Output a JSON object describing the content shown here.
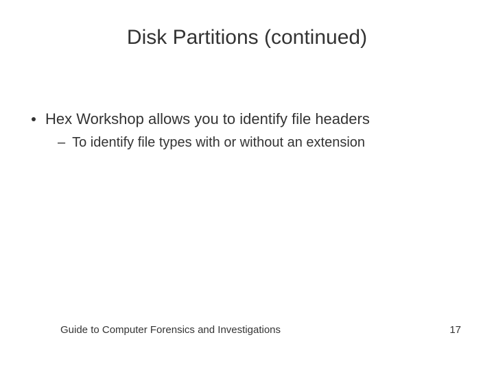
{
  "slide": {
    "title": "Disk Partitions (continued)",
    "bullets": [
      {
        "text": "Hex Workshop allows you to identify file headers",
        "sub": [
          {
            "text": "To identify file types with or without an extension"
          }
        ]
      }
    ],
    "footer": {
      "left": "Guide to Computer Forensics and Investigations",
      "page": "17"
    }
  }
}
